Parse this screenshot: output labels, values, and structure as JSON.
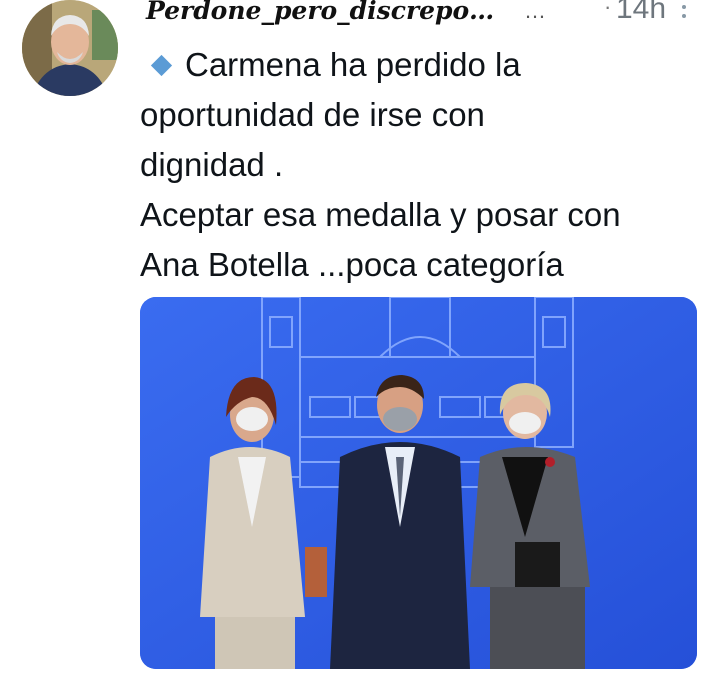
{
  "tweet": {
    "display_name": "Perdone_pero_discrepo…",
    "ellipsis": "…",
    "separator": "·",
    "timestamp": "14h",
    "text_lines": [
      "Carmena ha perdido la",
      "oportunidad de irse con",
      "dignidad .",
      "Aceptar esa medalla y posar con",
      "Ana Botella ...poca categoría"
    ],
    "bullet_color": "#5b9bd5"
  },
  "icons": {
    "more": "more-vertical-icon",
    "bullet": "blue-diamond-icon"
  },
  "colors": {
    "media_background": "#2f5fe6",
    "timestamp": "#6e767d"
  }
}
